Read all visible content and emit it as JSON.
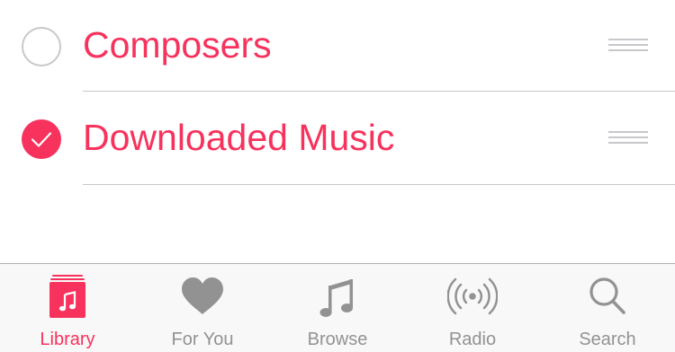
{
  "colors": {
    "accent": "#f7325d",
    "inactive_tab": "#929292",
    "separator": "#c8c7cc"
  },
  "list": {
    "items": [
      {
        "label": "Composers",
        "checked": false,
        "icon": "unchecked-circle-icon"
      },
      {
        "label": "Downloaded Music",
        "checked": true,
        "icon": "checkmark-circle-icon"
      }
    ]
  },
  "tabbar": {
    "active": "Library",
    "tabs": [
      {
        "label": "Library",
        "icon": "library-icon"
      },
      {
        "label": "For You",
        "icon": "heart-icon"
      },
      {
        "label": "Browse",
        "icon": "music-note-icon"
      },
      {
        "label": "Radio",
        "icon": "radio-broadcast-icon"
      },
      {
        "label": "Search",
        "icon": "search-icon"
      }
    ]
  }
}
